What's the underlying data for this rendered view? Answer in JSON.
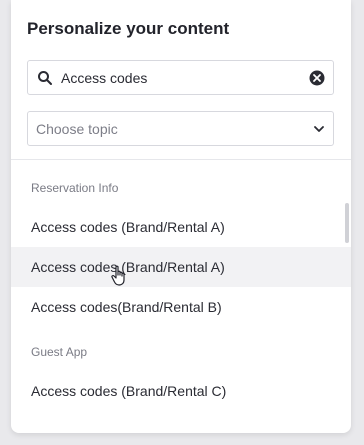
{
  "panel": {
    "title": "Personalize your content"
  },
  "search": {
    "value": "Access codes",
    "icon": "search-icon",
    "clear_icon": "clear-icon"
  },
  "topic_select": {
    "placeholder": "Choose topic",
    "icon": "chevron-down-icon"
  },
  "groups": [
    {
      "header": "Reservation Info",
      "options": [
        "Access codes (Brand/Rental A)",
        "Access codes (Brand/Rental A)",
        "Access codes(Brand/Rental B)"
      ]
    },
    {
      "header": "Guest App",
      "options": [
        "Access codes (Brand/Rental C)"
      ]
    }
  ],
  "colors": {
    "background": "#e9e9ec",
    "panel": "#ffffff",
    "hover_row": "#f2f2f4",
    "border": "#d7d8de",
    "muted_text": "#7a7b85"
  }
}
